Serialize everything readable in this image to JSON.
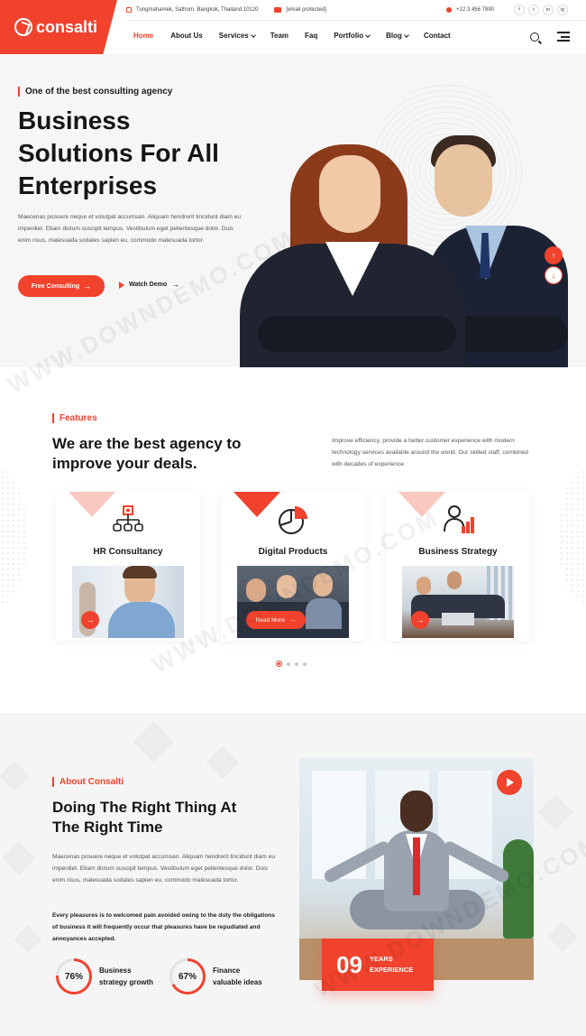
{
  "brand": {
    "name": "consalti",
    "accent": "#f0422d"
  },
  "topbar": {
    "address": "Tungmahamek, Sathorn, Bangkok, Thailand 10120",
    "email": "[email protected]",
    "phone": "+12 3 456 7890",
    "socials": [
      "f",
      "t",
      "in",
      "ig"
    ]
  },
  "nav": {
    "items": [
      {
        "label": "Home",
        "active": true,
        "dropdown": false
      },
      {
        "label": "About Us",
        "active": false,
        "dropdown": false
      },
      {
        "label": "Services",
        "active": false,
        "dropdown": true
      },
      {
        "label": "Team",
        "active": false,
        "dropdown": false
      },
      {
        "label": "Faq",
        "active": false,
        "dropdown": false
      },
      {
        "label": "Portfolio",
        "active": false,
        "dropdown": true
      },
      {
        "label": "Blog",
        "active": false,
        "dropdown": true
      },
      {
        "label": "Contact",
        "active": false,
        "dropdown": false
      }
    ]
  },
  "hero": {
    "tagline": "One of the best consulting agency",
    "title_lines": [
      "Business",
      "Solutions For All",
      "Enterprises"
    ],
    "text": "Maecenas posuere neque et volutpat accumsan. Aliquam hendrerit tincidunt diam eu imperdiet. Etiam dictum suscipit tempus. Vestibulum eget pellentesque dolor. Duis enim risus, malesuada sodales sapien eu, commodo malesuada tortor.",
    "primary_button": "Free Consulting",
    "watch_button": "Watch Demo"
  },
  "features": {
    "tag": "Features",
    "title_lines": [
      "We are the best agency to",
      "improve your deals."
    ],
    "text": "Improve efficiency, provide a better customer experience with modern technology services available around the world. Our skilled staff, combined with decades of experience.",
    "cards": [
      {
        "title": "HR Consultancy",
        "icon": "org-chart-icon"
      },
      {
        "title": "Digital Products",
        "icon": "pie-chart-icon",
        "button": "Read More"
      },
      {
        "title": "Business Strategy",
        "icon": "growth-chart-icon"
      }
    ]
  },
  "about": {
    "tag": "About Consalti",
    "title_lines": [
      "Doing The Right Thing At",
      "The Right Time"
    ],
    "p1": "Maecenas posuere neque et volutpat accumsan. Aliquam hendrerit tincidunt diam eu imperdiet. Etiam dictum suscipit tempus. Vestibulum eget pellentesque dolor. Duis enim risus, malesuada sodales sapien eu, commodo malesuada tortor.",
    "p2": "Every pleasures is to welcomed pain avoided owing to the duty the obligations of business it will frequently occur that pleasures have be repudiated and annoyances accepted.",
    "stats": [
      {
        "value": "76%",
        "percent": 76,
        "label_lines": [
          "Business",
          "strategy growth"
        ]
      },
      {
        "value": "67%",
        "percent": 67,
        "label_lines": [
          "Finance",
          "valuable ideas"
        ]
      }
    ],
    "years_number": "09",
    "years_label_lines": [
      "YEARS",
      "EXPERIENCE"
    ]
  },
  "watermark": "WWW.DOWNDEMO.COM"
}
